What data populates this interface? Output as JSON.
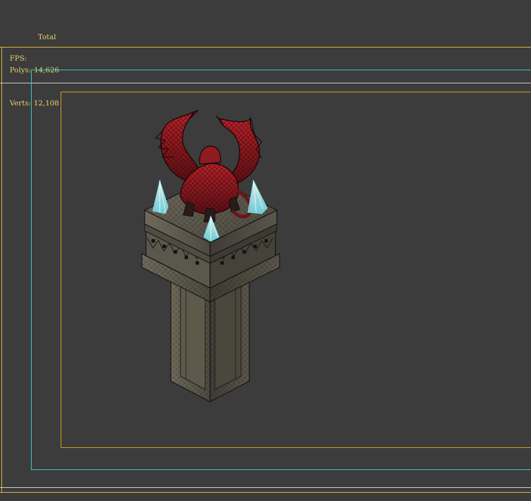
{
  "viewport": {
    "stats": {
      "header": "Total",
      "polys_label": "Polys:",
      "polys_value": "14,626",
      "verts_label": "Verts:",
      "verts_value": "12,108"
    },
    "fps_label": "FPS:",
    "colors": {
      "background": "#3c3c3c",
      "stats_text": "#e8d36a",
      "safe_frame_outer": "#d8b93a",
      "safe_frame_action": "#3fc8c8",
      "safe_frame_title": "#d8a21c",
      "divider_white": "#cfcfcf"
    },
    "scene_object": {
      "name": "dragon-statue-pedestal",
      "crystal_count": 3
    }
  }
}
